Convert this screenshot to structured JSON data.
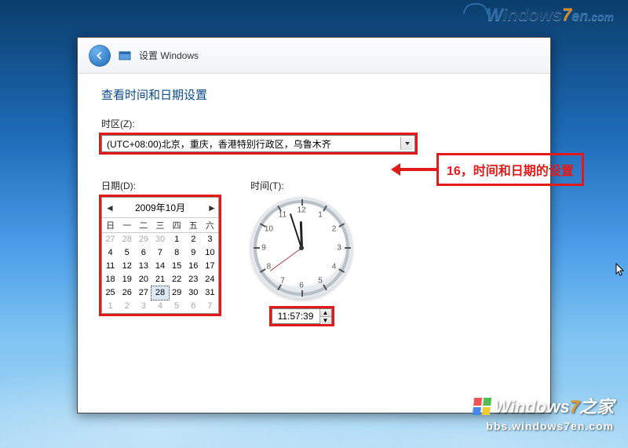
{
  "header": {
    "window_title": "设置 Windows"
  },
  "section": {
    "title": "查看时间和日期设置",
    "timezone_label": "时区(Z):",
    "timezone_value": "(UTC+08:00)北京，重庆，香港特别行政区，乌鲁木齐",
    "date_label": "日期(D):",
    "time_label": "时间(T):"
  },
  "calendar": {
    "month_title": "2009年10月",
    "dow": [
      "日",
      "一",
      "二",
      "三",
      "四",
      "五",
      "六"
    ],
    "weeks": [
      [
        {
          "d": 27,
          "other": true
        },
        {
          "d": 28,
          "other": true
        },
        {
          "d": 29,
          "other": true
        },
        {
          "d": 30,
          "other": true
        },
        {
          "d": 1
        },
        {
          "d": 2
        },
        {
          "d": 3
        }
      ],
      [
        {
          "d": 4
        },
        {
          "d": 5
        },
        {
          "d": 6
        },
        {
          "d": 7
        },
        {
          "d": 8
        },
        {
          "d": 9
        },
        {
          "d": 10
        }
      ],
      [
        {
          "d": 11
        },
        {
          "d": 12
        },
        {
          "d": 13
        },
        {
          "d": 14
        },
        {
          "d": 15
        },
        {
          "d": 16
        },
        {
          "d": 17
        }
      ],
      [
        {
          "d": 18
        },
        {
          "d": 19
        },
        {
          "d": 20
        },
        {
          "d": 21
        },
        {
          "d": 22
        },
        {
          "d": 23
        },
        {
          "d": 24
        }
      ],
      [
        {
          "d": 25
        },
        {
          "d": 26
        },
        {
          "d": 27
        },
        {
          "d": 28,
          "sel": true
        },
        {
          "d": 29
        },
        {
          "d": 30
        },
        {
          "d": 31
        }
      ],
      [
        {
          "d": 1,
          "other": true
        },
        {
          "d": 2,
          "other": true
        },
        {
          "d": 3,
          "other": true
        },
        {
          "d": 4,
          "other": true
        },
        {
          "d": 5,
          "other": true
        },
        {
          "d": 6,
          "other": true
        },
        {
          "d": 7,
          "other": true
        }
      ]
    ]
  },
  "time": {
    "value": "11:57:39",
    "hour_angle": 358,
    "minute_angle": 342,
    "second_angle": 234
  },
  "annotation": {
    "text": "16，时间和日期的设置"
  },
  "branding": {
    "top_logo": "Windows7en.com",
    "bottom_brand": "Windows7之家",
    "bottom_url": "bbs.windows7en.com"
  }
}
